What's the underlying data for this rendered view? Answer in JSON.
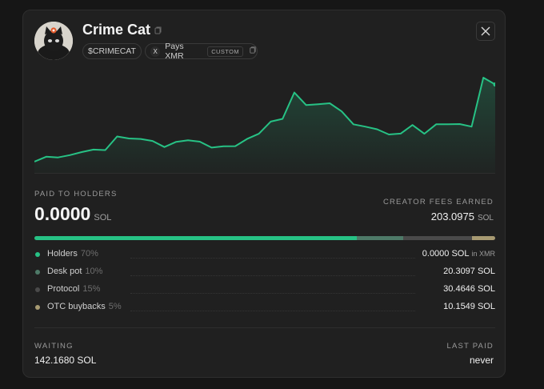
{
  "token": {
    "name": "Crime Cat",
    "ticker": "$CRIMECAT",
    "pays_prefix": "X",
    "pays_label": "Pays XMR",
    "custom_tag": "CUSTOM"
  },
  "header_icons": [
    "copy-icon",
    "x-logo-icon"
  ],
  "chart_data": {
    "type": "area",
    "color": "#27c285",
    "values": [
      0.5,
      3.2,
      2.8,
      4.1,
      5.8,
      7.2,
      6.9,
      14.5,
      13.4,
      13.1,
      12.0,
      8.6,
      11.5,
      12.4,
      11.6,
      8.3,
      9.0,
      9.1,
      13.1,
      16.0,
      22.8,
      24.3,
      39.0,
      32.0,
      32.5,
      33.0,
      28.5,
      21.3,
      20.0,
      18.5,
      15.6,
      16.1,
      20.9,
      16.0,
      21.3,
      21.3,
      21.4,
      20.0,
      47.3,
      43.5
    ]
  },
  "paid": {
    "label": "PAID TO HOLDERS",
    "value": "0.0000",
    "unit": "SOL"
  },
  "fees": {
    "label": "CREATOR FEES EARNED",
    "value": "203.0975",
    "unit": "SOL"
  },
  "distribution": [
    {
      "name": "Holders",
      "pct": "70%",
      "share": 70,
      "value": "0.0000 SOL",
      "sub": "in XMR",
      "color": "#27c285"
    },
    {
      "name": "Desk pot",
      "pct": "10%",
      "share": 10,
      "value": "20.3097 SOL",
      "sub": "",
      "color": "#4e7a68"
    },
    {
      "name": "Protocol",
      "pct": "15%",
      "share": 15,
      "value": "30.4646 SOL",
      "sub": "",
      "color": "#4a4a4a"
    },
    {
      "name": "OTC buybacks",
      "pct": "5%",
      "share": 5,
      "value": "10.1549 SOL",
      "sub": "",
      "color": "#a79a72"
    }
  ],
  "waiting": {
    "label": "WAITING",
    "value": "142.1680 SOL"
  },
  "last_paid": {
    "label": "LAST PAID",
    "value": "never"
  }
}
